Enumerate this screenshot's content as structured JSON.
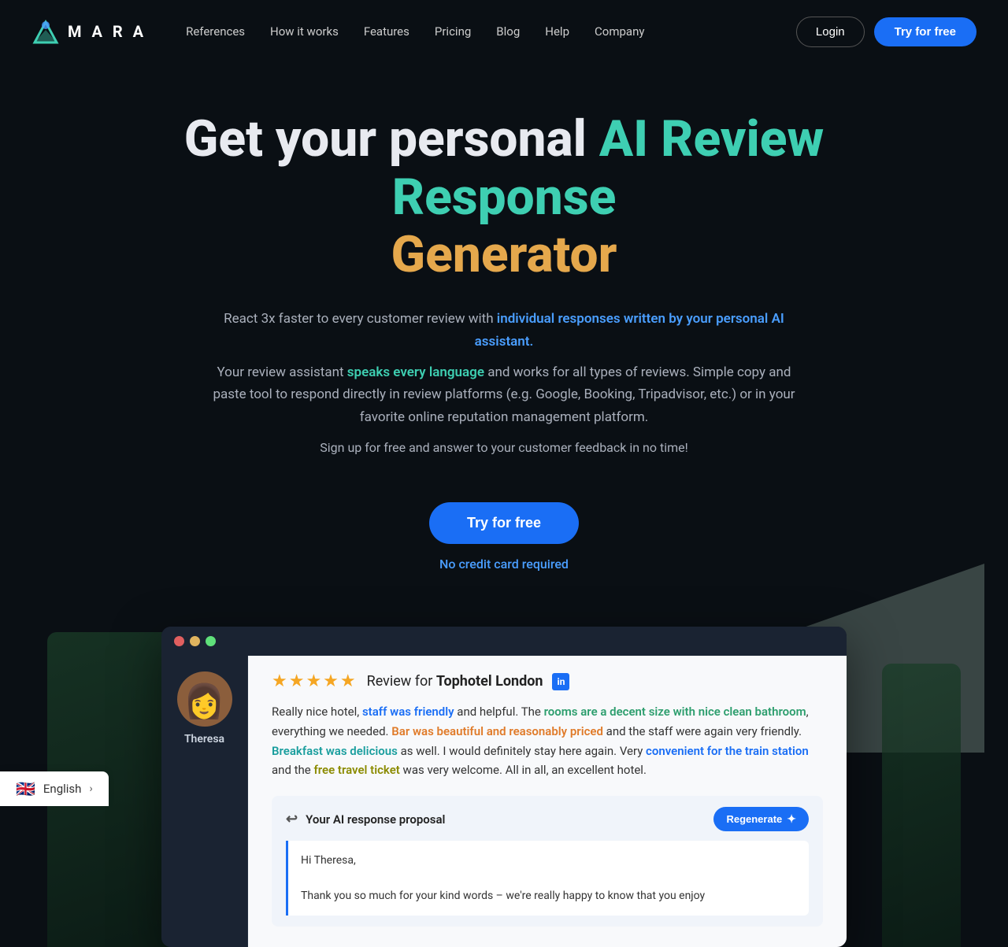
{
  "nav": {
    "logo_text": "M A R A",
    "links": [
      {
        "label": "References",
        "id": "references"
      },
      {
        "label": "How it works",
        "id": "how-it-works"
      },
      {
        "label": "Features",
        "id": "features"
      },
      {
        "label": "Pricing",
        "id": "pricing"
      },
      {
        "label": "Blog",
        "id": "blog"
      },
      {
        "label": "Help",
        "id": "help"
      },
      {
        "label": "Company",
        "id": "company"
      }
    ],
    "login_label": "Login",
    "try_label": "Try for free"
  },
  "hero": {
    "headline_prefix": "Get your personal ",
    "headline_highlight1": "AI Review Response",
    "headline_suffix": "",
    "headline_highlight2": "Generator",
    "subtext1": "React 3x faster to every customer review with ",
    "subtext1_link": "individual responses written by your personal AI assistant.",
    "subtext2": "Your review assistant ",
    "subtext2_link": "speaks every language",
    "subtext2_cont": " and works for all types of reviews. Simple copy and paste tool to respond directly in review platforms (e.g. Google, Booking, Tripadvisor, etc.) or in your favorite online reputation management platform.",
    "subtext3": "Sign up for free and answer to your customer feedback in no time!",
    "cta_label": "Try for free",
    "no_cc_text": "No credit card required"
  },
  "demo": {
    "reviewer_name": "Theresa",
    "stars": "★★★★★",
    "review_header": "Review for ",
    "hotel_name": "Tophotel London",
    "review_body_1": "Really nice hotel, ",
    "review_hl1": "staff was friendly",
    "review_body_2": " and helpful. The ",
    "review_hl2": "rooms are a decent size with nice clean bathroom",
    "review_body_3": ", everything we needed.  ",
    "review_hl3": "Bar was beautiful and reasonably priced",
    "review_body_4": " and the staff were again very friendly. ",
    "review_hl4": "Breakfast was delicious",
    "review_body_5": " as well. I would definitely stay here again. Very ",
    "review_hl5": "convenient for the train station",
    "review_body_6": " and the ",
    "review_hl6": "free travel ticket",
    "review_body_7": " was very welcome. All in all, an excellent hotel.",
    "ai_section_title": "Your AI response proposal",
    "regenerate_label": "Regenerate",
    "ai_response_line1": "Hi Theresa,",
    "ai_response_line2": "Thank you so much for your kind words – we're really happy to know that you enjoy"
  },
  "footer": {
    "flag_emoji": "🇬🇧",
    "language": "English"
  }
}
